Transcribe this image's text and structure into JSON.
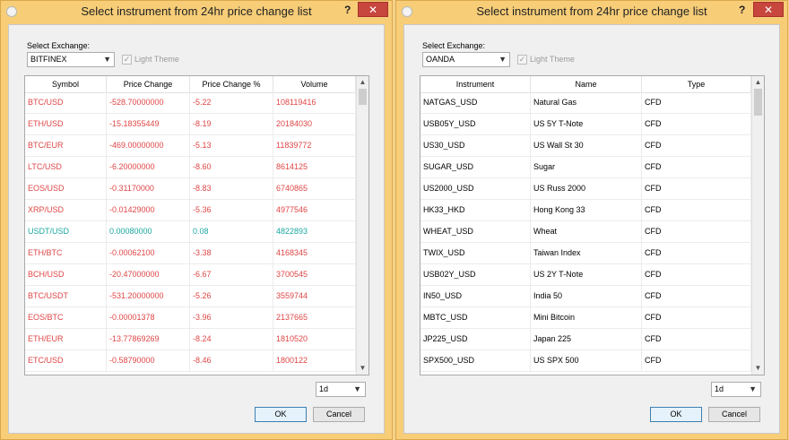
{
  "dialogs": [
    {
      "title": "Select instrument from 24hr price change list",
      "help_label": "?",
      "close_label": "✕",
      "exchange_label": "Select Exchange:",
      "exchange_value": "BITFINEX",
      "light_theme_label": "Light Theme",
      "columns": [
        "Symbol",
        "Price Change",
        "Price Change %",
        "Volume"
      ],
      "rows": [
        [
          "BTC/USD",
          "-528.70000000",
          "-5.22",
          "108119416"
        ],
        [
          "ETH/USD",
          "-15.18355449",
          "-8.19",
          "20184030"
        ],
        [
          "BTC/EUR",
          "-469.00000000",
          "-5.13",
          "11839772"
        ],
        [
          "LTC/USD",
          "-6.20000000",
          "-8.60",
          "8614125"
        ],
        [
          "EOS/USD",
          "-0.31170000",
          "-8.83",
          "6740865"
        ],
        [
          "XRP/USD",
          "-0.01429000",
          "-5.36",
          "4977546"
        ],
        [
          "USDT/USD",
          "0.00080000",
          "0.08",
          "4822893"
        ],
        [
          "ETH/BTC",
          "-0.00062100",
          "-3.38",
          "4168345"
        ],
        [
          "BCH/USD",
          "-20.47000000",
          "-6.67",
          "3700545"
        ],
        [
          "BTC/USDT",
          "-531.20000000",
          "-5.26",
          "3559744"
        ],
        [
          "EOS/BTC",
          "-0.00001378",
          "-3.96",
          "2137665"
        ],
        [
          "ETH/EUR",
          "-13.77869269",
          "-8.24",
          "1810520"
        ],
        [
          "ETC/USD",
          "-0.58790000",
          "-8.46",
          "1800122"
        ]
      ],
      "row_colors": [
        "red",
        "red",
        "red",
        "red",
        "red",
        "red",
        "teal",
        "red",
        "red",
        "red",
        "red",
        "red",
        "red"
      ],
      "period_value": "1d",
      "ok_label": "OK",
      "cancel_label": "Cancel"
    },
    {
      "title": "Select instrument from 24hr price change list",
      "help_label": "?",
      "close_label": "✕",
      "exchange_label": "Select Exchange:",
      "exchange_value": "OANDA",
      "light_theme_label": "Light Theme",
      "columns": [
        "Instrument",
        "Name",
        "Type"
      ],
      "rows": [
        [
          "NATGAS_USD",
          "Natural Gas",
          "CFD"
        ],
        [
          "USB05Y_USD",
          "US 5Y T-Note",
          "CFD"
        ],
        [
          "US30_USD",
          "US Wall St 30",
          "CFD"
        ],
        [
          "SUGAR_USD",
          "Sugar",
          "CFD"
        ],
        [
          "US2000_USD",
          "US Russ 2000",
          "CFD"
        ],
        [
          "HK33_HKD",
          "Hong Kong 33",
          "CFD"
        ],
        [
          "WHEAT_USD",
          "Wheat",
          "CFD"
        ],
        [
          "TWIX_USD",
          "Taiwan Index",
          "CFD"
        ],
        [
          "USB02Y_USD",
          "US 2Y T-Note",
          "CFD"
        ],
        [
          "IN50_USD",
          "India 50",
          "CFD"
        ],
        [
          "MBTC_USD",
          "Mini Bitcoin",
          "CFD"
        ],
        [
          "JP225_USD",
          "Japan 225",
          "CFD"
        ],
        [
          "SPX500_USD",
          "US SPX 500",
          "CFD"
        ]
      ],
      "period_value": "1d",
      "ok_label": "OK",
      "cancel_label": "Cancel"
    }
  ],
  "colors": {
    "red": "#e04646",
    "teal": "#1aa7a0",
    "title_bg": "#f7cd78",
    "close_bg": "#c7463e"
  },
  "icons": {
    "app": "app-icon",
    "help": "help-icon",
    "close": "close-icon",
    "dropdown": "chevron-down-icon",
    "scroll_up": "scroll-up-icon",
    "scroll_down": "scroll-down-icon",
    "checkbox": "checkbox-checked-icon"
  }
}
